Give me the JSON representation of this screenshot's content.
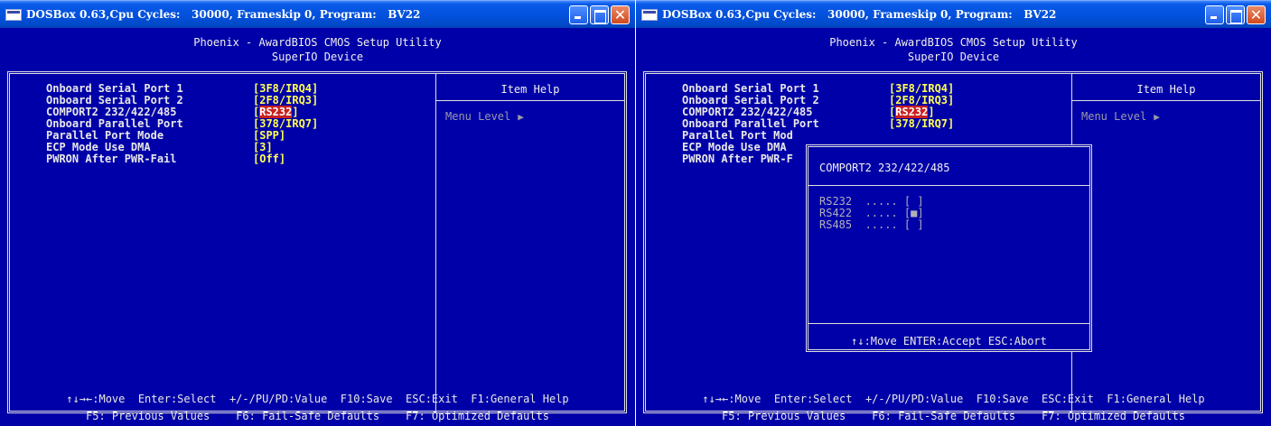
{
  "windows": [
    {
      "title": "DOSBox 0.63,Cpu Cycles:   30000, Frameskip 0, Program:   BV22",
      "header_line1": "Phoenix - AwardBIOS CMOS Setup Utility",
      "header_line2": "SuperIO Device",
      "items": [
        {
          "label": "Onboard Serial Port 1",
          "value_open": "[",
          "value": "3F8/IRQ4",
          "value_close": "]"
        },
        {
          "label": "Onboard Serial Port 2",
          "value_open": "[",
          "value": "2F8/IRQ3",
          "value_close": "]"
        },
        {
          "label": "COMPORT2 232/422/485",
          "value_open": "[",
          "value": "RS232",
          "value_close": "]"
        },
        {
          "label": "Onboard Parallel Port",
          "value_open": "[",
          "value": "378/IRQ7",
          "value_close": "]"
        },
        {
          "label": "Parallel Port Mode",
          "value_open": "[",
          "value": "SPP",
          "value_close": "]"
        },
        {
          "label": "ECP Mode Use DMA",
          "value_open": "[",
          "value": "3",
          "value_close": "]"
        },
        {
          "label": "PWRON After PWR-Fail",
          "value_open": "[",
          "value": "Off",
          "value_close": "]"
        }
      ],
      "help_title": "Item Help",
      "menu_level": "Menu Level",
      "menu_level_arrow": "▶",
      "footer_line1": "↑↓→←:Move  Enter:Select  +/-/PU/PD:Value  F10:Save  ESC:Exit  F1:General Help",
      "footer_line2": "F5: Previous Values    F6: Fail-Safe Defaults    F7: Optimized Defaults"
    },
    {
      "title": "DOSBox 0.63,Cpu Cycles:   30000, Frameskip 0, Program:   BV22",
      "header_line1": "Phoenix - AwardBIOS CMOS Setup Utility",
      "header_line2": "SuperIO Device",
      "items": [
        {
          "label": "Onboard Serial Port 1",
          "value_open": "[",
          "value": "3F8/IRQ4",
          "value_close": "]"
        },
        {
          "label": "Onboard Serial Port 2",
          "value_open": "[",
          "value": "2F8/IRQ3",
          "value_close": "]"
        },
        {
          "label": "COMPORT2 232/422/485",
          "value_open": "[",
          "value": "RS232",
          "value_close": "]"
        },
        {
          "label": "Onboard Parallel Port",
          "value_open": "[",
          "value": "378/IRQ7",
          "value_close": "]"
        },
        {
          "label": "Parallel Port Mod",
          "value_open": "",
          "value": "",
          "value_close": ""
        },
        {
          "label": "ECP Mode Use DMA",
          "value_open": "",
          "value": "",
          "value_close": ""
        },
        {
          "label": "PWRON After PWR-F",
          "value_open": "",
          "value": "",
          "value_close": ""
        }
      ],
      "help_title": "Item Help",
      "menu_level": "Menu Level",
      "menu_level_arrow": "▶",
      "footer_line1": "↑↓→←:Move  Enter:Select  +/-/PU/PD:Value  F10:Save  ESC:Exit  F1:General Help",
      "footer_line2": "F5: Previous Values    F6: Fail-Safe Defaults    F7: Optimized Defaults",
      "popup": {
        "title": "COMPORT2 232/422/485",
        "options": [
          {
            "label": "RS232",
            "dots": "  .....",
            "box": " [ ]"
          },
          {
            "label": "RS422",
            "dots": "  .....",
            "box": " [■]"
          },
          {
            "label": "RS485",
            "dots": "  .....",
            "box": " [ ]"
          }
        ],
        "hint": "↑↓:Move ENTER:Accept ESC:Abort"
      }
    }
  ],
  "colors": {
    "bios_background": "#0000a8",
    "value_text": "#ffff55",
    "selection_highlight": "#c82020",
    "titlebar_blue": "#0352de"
  }
}
